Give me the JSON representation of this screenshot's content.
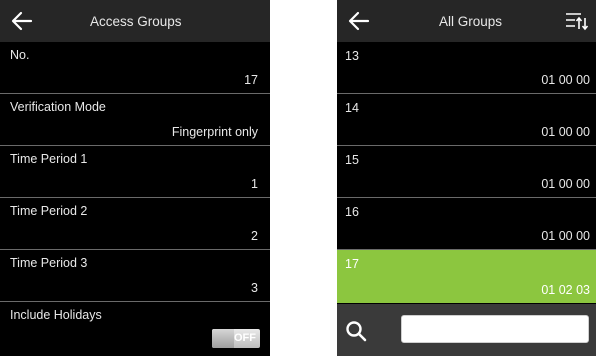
{
  "left": {
    "title": "Access Groups",
    "fields": [
      {
        "label": "No.",
        "value": "17"
      },
      {
        "label": "Verification Mode",
        "value": "Fingerprint only"
      },
      {
        "label": "Time Period 1",
        "value": "1"
      },
      {
        "label": "Time Period 2",
        "value": "2"
      },
      {
        "label": "Time Period 3",
        "value": "3"
      }
    ],
    "holidays": {
      "label": "Include Holidays",
      "toggle": "OFF"
    }
  },
  "right": {
    "title": "All Groups",
    "groups": [
      {
        "id": "13",
        "periods": "01 00 00"
      },
      {
        "id": "14",
        "periods": "01 00 00"
      },
      {
        "id": "15",
        "periods": "01 00 00"
      },
      {
        "id": "16",
        "periods": "01 00 00"
      },
      {
        "id": "17",
        "periods": "01 02 03"
      }
    ],
    "selected_group": "17",
    "search": {
      "value": "",
      "placeholder": ""
    }
  },
  "colors": {
    "screen_bg": "#000000",
    "topbar_bg": "#262626",
    "selected_row": "#8cc63f",
    "search_bar_bg": "#3a3a3a"
  },
  "icons": [
    "back-arrow-icon",
    "sort-icon",
    "search-icon"
  ]
}
